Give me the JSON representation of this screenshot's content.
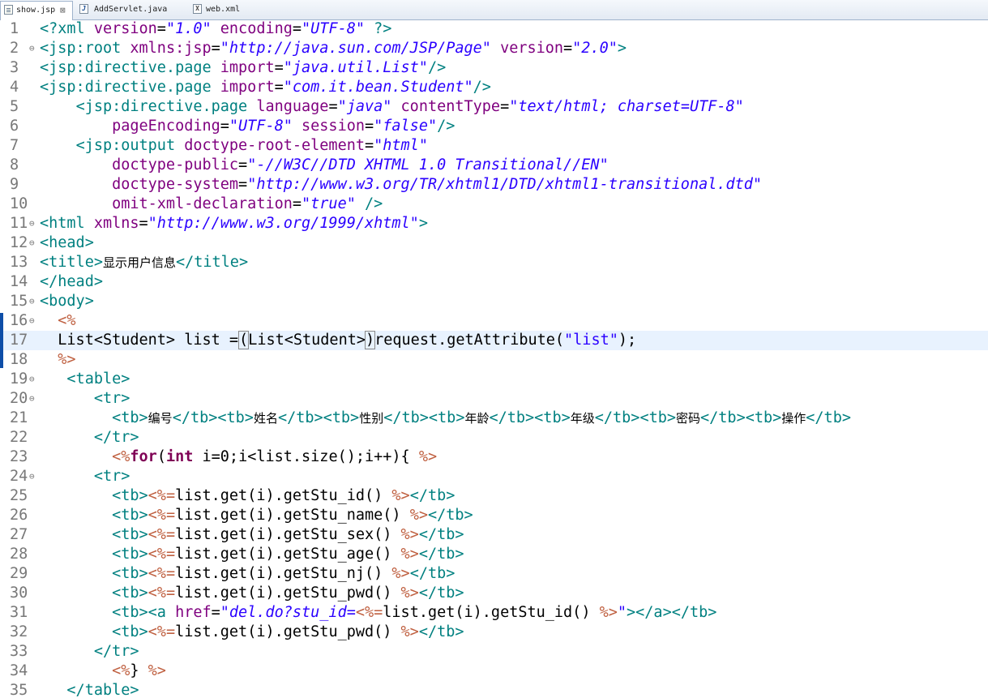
{
  "tabs": [
    {
      "name": "show.jsp",
      "close": "⊠"
    },
    {
      "name": "AddServlet.java"
    },
    {
      "name": "web.xml"
    }
  ],
  "icons": {
    "tab_jsp": "jsp-file-icon",
    "tab_java": "java-file-icon",
    "tab_xml": "xml-file-icon",
    "fold": "fold-toggle-icon"
  },
  "colors": {
    "tag": "#008080",
    "attr": "#7f007f",
    "value": "#2a00ff",
    "delim": "#bf5f3f",
    "keyword": "#7f0055",
    "current_line": "#e8f2fe",
    "change_marker": "#0e4ea8"
  },
  "editor": {
    "current_line": 17,
    "change_markers": [
      16,
      17,
      18
    ],
    "fold_lines": [
      2,
      11,
      12,
      15,
      16,
      19,
      20,
      24
    ],
    "lines": [
      {
        "n": "1",
        "tokens": [
          [
            "t",
            "<?xml "
          ],
          [
            "a",
            "version"
          ],
          [
            "p",
            "="
          ],
          [
            "v",
            "\"1.0\""
          ],
          [
            "p",
            " "
          ],
          [
            "a",
            "encoding"
          ],
          [
            "p",
            "="
          ],
          [
            "v",
            "\"UTF-8\""
          ],
          [
            "t",
            " ?>"
          ]
        ]
      },
      {
        "n": "2",
        "tokens": [
          [
            "t",
            "<jsp:root "
          ],
          [
            "a",
            "xmlns:jsp"
          ],
          [
            "p",
            "="
          ],
          [
            "v",
            "\"http://java.sun.com/JSP/Page\""
          ],
          [
            "p",
            " "
          ],
          [
            "a",
            "version"
          ],
          [
            "p",
            "="
          ],
          [
            "v",
            "\"2.0\""
          ],
          [
            "t",
            ">"
          ]
        ]
      },
      {
        "n": "3",
        "tokens": [
          [
            "t",
            "<jsp:directive.page "
          ],
          [
            "a",
            "import"
          ],
          [
            "p",
            "="
          ],
          [
            "v",
            "\"java.util.List\""
          ],
          [
            "t",
            "/>"
          ]
        ]
      },
      {
        "n": "4",
        "tokens": [
          [
            "t",
            "<jsp:directive.page "
          ],
          [
            "a",
            "import"
          ],
          [
            "p",
            "="
          ],
          [
            "v",
            "\"com.it.bean.Student\""
          ],
          [
            "t",
            "/>"
          ]
        ]
      },
      {
        "n": "5",
        "tokens": [
          [
            "p",
            "    "
          ],
          [
            "t",
            "<jsp:directive.page "
          ],
          [
            "a",
            "language"
          ],
          [
            "p",
            "="
          ],
          [
            "v",
            "\"java\""
          ],
          [
            "p",
            " "
          ],
          [
            "a",
            "contentType"
          ],
          [
            "p",
            "="
          ],
          [
            "v",
            "\"text/html; charset=UTF-8\""
          ]
        ]
      },
      {
        "n": "6",
        "tokens": [
          [
            "p",
            "        "
          ],
          [
            "a",
            "pageEncoding"
          ],
          [
            "p",
            "="
          ],
          [
            "v",
            "\"UTF-8\""
          ],
          [
            "p",
            " "
          ],
          [
            "a",
            "session"
          ],
          [
            "p",
            "="
          ],
          [
            "v",
            "\"false\""
          ],
          [
            "t",
            "/>"
          ]
        ]
      },
      {
        "n": "7",
        "tokens": [
          [
            "p",
            "    "
          ],
          [
            "t",
            "<jsp:output "
          ],
          [
            "a",
            "doctype-root-element"
          ],
          [
            "p",
            "="
          ],
          [
            "v",
            "\"html\""
          ]
        ]
      },
      {
        "n": "8",
        "tokens": [
          [
            "p",
            "        "
          ],
          [
            "a",
            "doctype-public"
          ],
          [
            "p",
            "="
          ],
          [
            "v",
            "\"-//W3C//DTD XHTML 1.0 Transitional//EN\""
          ]
        ]
      },
      {
        "n": "9",
        "tokens": [
          [
            "p",
            "        "
          ],
          [
            "a",
            "doctype-system"
          ],
          [
            "p",
            "="
          ],
          [
            "v",
            "\"http://www.w3.org/TR/xhtml1/DTD/xhtml1-transitional.dtd\""
          ]
        ]
      },
      {
        "n": "10",
        "tokens": [
          [
            "p",
            "        "
          ],
          [
            "a",
            "omit-xml-declaration"
          ],
          [
            "p",
            "="
          ],
          [
            "v",
            "\"true\""
          ],
          [
            "p",
            " "
          ],
          [
            "t",
            "/>"
          ]
        ]
      },
      {
        "n": "11",
        "tokens": [
          [
            "t",
            "<html "
          ],
          [
            "a",
            "xmlns"
          ],
          [
            "p",
            "="
          ],
          [
            "v",
            "\"http://www.w3.org/1999/xhtml\""
          ],
          [
            "t",
            ">"
          ]
        ]
      },
      {
        "n": "12",
        "tokens": [
          [
            "t",
            "<head>"
          ]
        ]
      },
      {
        "n": "13",
        "tokens": [
          [
            "t",
            "<title>"
          ],
          [
            "cj",
            "显示用户信息"
          ],
          [
            "t",
            "</title>"
          ]
        ]
      },
      {
        "n": "14",
        "tokens": [
          [
            "t",
            "</head>"
          ]
        ]
      },
      {
        "n": "15",
        "tokens": [
          [
            "t",
            "<body>"
          ]
        ]
      },
      {
        "n": "16",
        "tokens": [
          [
            "p",
            "  "
          ],
          [
            "d",
            "<%"
          ]
        ]
      },
      {
        "n": "17",
        "tokens": [
          [
            "p",
            "  List<Student> list ="
          ],
          [
            "caret",
            ""
          ],
          [
            "brk",
            "("
          ],
          [
            "p",
            "List<Student>"
          ],
          [
            "brk",
            ")"
          ],
          [
            "p",
            "request.getAttribute("
          ],
          [
            "s",
            "\"list\""
          ],
          [
            "p",
            ");"
          ]
        ]
      },
      {
        "n": "18",
        "tokens": [
          [
            "p",
            "  "
          ],
          [
            "d",
            "%>"
          ]
        ]
      },
      {
        "n": "19",
        "tokens": [
          [
            "p",
            "   "
          ],
          [
            "t",
            "<table>"
          ]
        ]
      },
      {
        "n": "20",
        "tokens": [
          [
            "p",
            "      "
          ],
          [
            "t",
            "<tr>"
          ]
        ]
      },
      {
        "n": "21",
        "tokens": [
          [
            "p",
            "        "
          ],
          [
            "t",
            "<tb>"
          ],
          [
            "cj",
            "编号"
          ],
          [
            "t",
            "</tb><tb>"
          ],
          [
            "cj",
            "姓名"
          ],
          [
            "t",
            "</tb><tb>"
          ],
          [
            "cj",
            "性别"
          ],
          [
            "t",
            "</tb><tb>"
          ],
          [
            "cj",
            "年龄"
          ],
          [
            "t",
            "</tb><tb>"
          ],
          [
            "cj",
            "年级"
          ],
          [
            "t",
            "</tb><tb>"
          ],
          [
            "cj",
            "密码"
          ],
          [
            "t",
            "</tb><tb>"
          ],
          [
            "cj",
            "操作"
          ],
          [
            "t",
            "</tb>"
          ]
        ]
      },
      {
        "n": "22",
        "tokens": [
          [
            "p",
            "      "
          ],
          [
            "t",
            "</tr>"
          ]
        ]
      },
      {
        "n": "23",
        "tokens": [
          [
            "p",
            "        "
          ],
          [
            "d",
            "<%"
          ],
          [
            "k",
            "for"
          ],
          [
            "p",
            "("
          ],
          [
            "k",
            "int"
          ],
          [
            "p",
            " i=0;i<list.size();i++){ "
          ],
          [
            "d",
            "%>"
          ]
        ]
      },
      {
        "n": "24",
        "tokens": [
          [
            "p",
            "      "
          ],
          [
            "t",
            "<tr>"
          ]
        ]
      },
      {
        "n": "25",
        "tokens": [
          [
            "p",
            "        "
          ],
          [
            "t",
            "<tb>"
          ],
          [
            "d",
            "<%="
          ],
          [
            "p",
            "list.get(i).getStu_id() "
          ],
          [
            "d",
            "%>"
          ],
          [
            "t",
            "</tb>"
          ]
        ]
      },
      {
        "n": "26",
        "tokens": [
          [
            "p",
            "        "
          ],
          [
            "t",
            "<tb>"
          ],
          [
            "d",
            "<%="
          ],
          [
            "p",
            "list.get(i).getStu_name() "
          ],
          [
            "d",
            "%>"
          ],
          [
            "t",
            "</tb>"
          ]
        ]
      },
      {
        "n": "27",
        "tokens": [
          [
            "p",
            "        "
          ],
          [
            "t",
            "<tb>"
          ],
          [
            "d",
            "<%="
          ],
          [
            "p",
            "list.get(i).getStu_sex() "
          ],
          [
            "d",
            "%>"
          ],
          [
            "t",
            "</tb>"
          ]
        ]
      },
      {
        "n": "28",
        "tokens": [
          [
            "p",
            "        "
          ],
          [
            "t",
            "<tb>"
          ],
          [
            "d",
            "<%="
          ],
          [
            "p",
            "list.get(i).getStu_age() "
          ],
          [
            "d",
            "%>"
          ],
          [
            "t",
            "</tb>"
          ]
        ]
      },
      {
        "n": "29",
        "tokens": [
          [
            "p",
            "        "
          ],
          [
            "t",
            "<tb>"
          ],
          [
            "d",
            "<%="
          ],
          [
            "p",
            "list.get(i).getStu_nj() "
          ],
          [
            "d",
            "%>"
          ],
          [
            "t",
            "</tb>"
          ]
        ]
      },
      {
        "n": "30",
        "tokens": [
          [
            "p",
            "        "
          ],
          [
            "t",
            "<tb>"
          ],
          [
            "d",
            "<%="
          ],
          [
            "p",
            "list.get(i).getStu_pwd() "
          ],
          [
            "d",
            "%>"
          ],
          [
            "t",
            "</tb>"
          ]
        ]
      },
      {
        "n": "31",
        "tokens": [
          [
            "p",
            "        "
          ],
          [
            "t",
            "<tb><a "
          ],
          [
            "a",
            "href"
          ],
          [
            "p",
            "="
          ],
          [
            "v",
            "\"del.do?stu_id="
          ],
          [
            "d",
            "<%="
          ],
          [
            "p",
            "list.get(i).getStu_id() "
          ],
          [
            "d",
            "%>"
          ],
          [
            "v",
            "\""
          ],
          [
            "t",
            "></a></tb>"
          ]
        ]
      },
      {
        "n": "32",
        "tokens": [
          [
            "p",
            "        "
          ],
          [
            "t",
            "<tb>"
          ],
          [
            "d",
            "<%="
          ],
          [
            "p",
            "list.get(i).getStu_pwd() "
          ],
          [
            "d",
            "%>"
          ],
          [
            "t",
            "</tb>"
          ]
        ]
      },
      {
        "n": "33",
        "tokens": [
          [
            "p",
            "      "
          ],
          [
            "t",
            "</tr>"
          ]
        ]
      },
      {
        "n": "34",
        "tokens": [
          [
            "p",
            "        "
          ],
          [
            "d",
            "<%"
          ],
          [
            "p",
            "} "
          ],
          [
            "d",
            "%>"
          ]
        ]
      },
      {
        "n": "35",
        "tokens": [
          [
            "p",
            "   "
          ],
          [
            "t",
            "</table>"
          ]
        ]
      }
    ]
  }
}
